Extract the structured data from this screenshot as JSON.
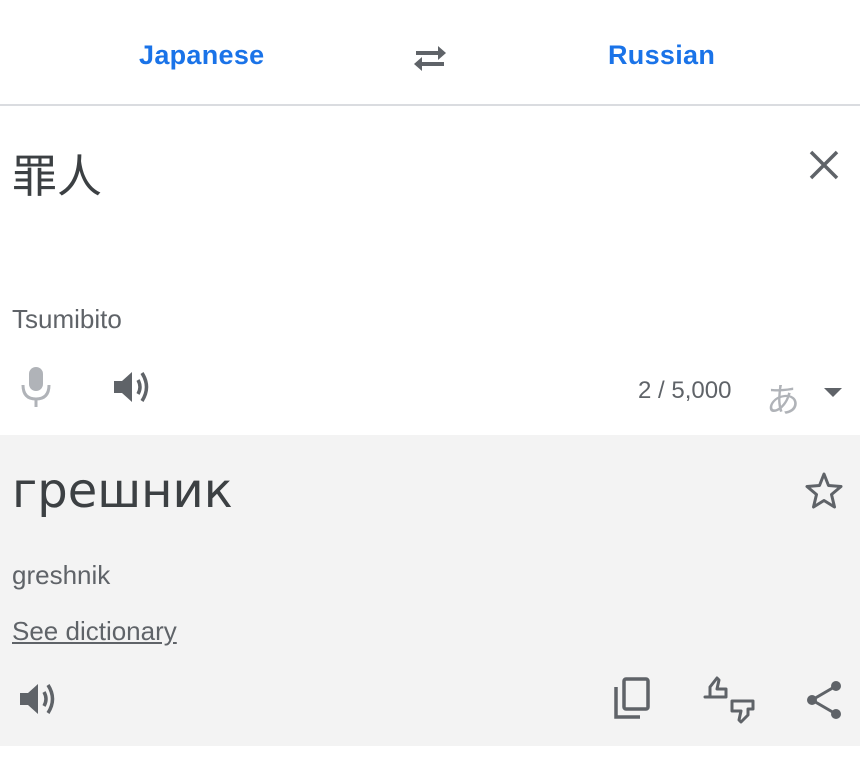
{
  "languages": {
    "source": "Japanese",
    "target": "Russian"
  },
  "source": {
    "text": "罪人",
    "transliteration": "Tsumibito",
    "char_count": "2 / 5,000",
    "input_method_glyph": "あ"
  },
  "result": {
    "text": "грешник",
    "transliteration": "greshnik",
    "dictionary_link": "See dictionary"
  },
  "icons": {
    "swap": "swap-arrows-icon",
    "clear": "close-icon",
    "mic": "microphone-icon",
    "speaker": "speaker-icon",
    "star": "star-icon",
    "copy": "copy-icon",
    "rate": "thumbs-rating-icon",
    "share": "share-icon"
  },
  "colors": {
    "accent": "#1a73e8",
    "icon": "#5f6368",
    "result_bg": "#f3f3f3"
  }
}
